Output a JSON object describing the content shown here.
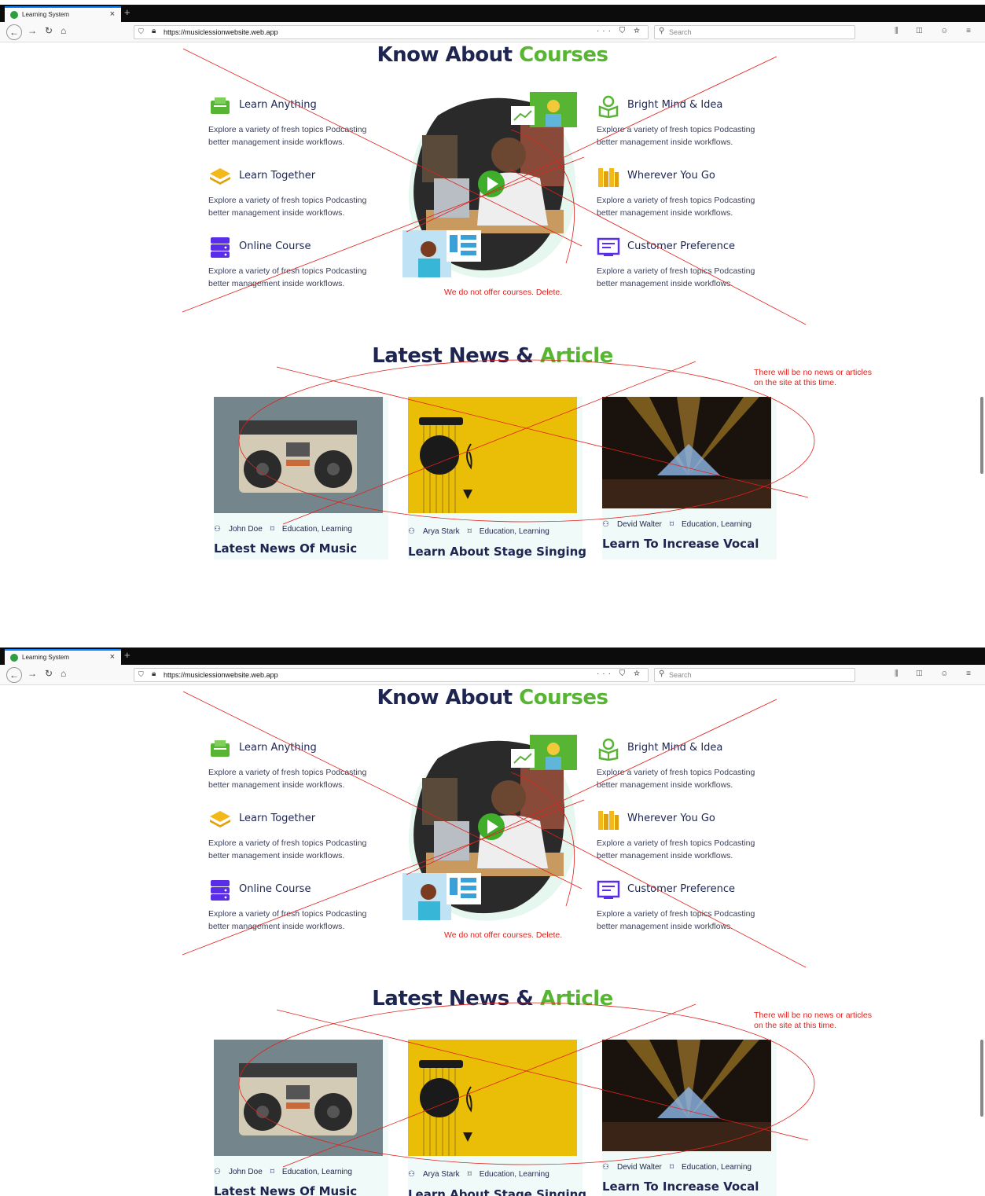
{
  "browser": {
    "tab_title": "Learning System",
    "url": "https://musiclessionwebsite.web.app",
    "search_placeholder": "Search"
  },
  "courses": {
    "heading_part1": "Know About ",
    "heading_accent": "Courses",
    "features_left": [
      {
        "title": "Learn Anything",
        "desc": "Explore a variety of fresh topics Podcasting better management inside workflows.",
        "icon": "book-icon",
        "color": "#58b433"
      },
      {
        "title": "Learn Together",
        "desc": "Explore a variety of fresh topics Podcasting better management inside workflows.",
        "icon": "layers-icon",
        "color": "#f3b81a"
      },
      {
        "title": "Online Course",
        "desc": "Explore a variety of fresh topics Podcasting better management inside workflows.",
        "icon": "server-icon",
        "color": "#5a2ee8"
      }
    ],
    "features_right": [
      {
        "title": "Bright Mind & Idea",
        "desc": "Explore a variety of fresh topics Podcasting better management inside workflows.",
        "icon": "idea-icon",
        "color": "#58b433"
      },
      {
        "title": "Wherever You Go",
        "desc": "Explore a variety of fresh topics Podcasting better management inside workflows.",
        "icon": "library-icon",
        "color": "#f3b81a"
      },
      {
        "title": "Customer Preference",
        "desc": "Explore a variety of fresh topics Podcasting better management inside workflows.",
        "icon": "certificate-icon",
        "color": "#5a2ee8"
      }
    ],
    "annotation": "We do not offer courses. Delete."
  },
  "news": {
    "heading_part1": "Latest News & ",
    "heading_accent": "Article",
    "annotation_line1": "There will be no news or articles",
    "annotation_line2": "on the site at this time.",
    "cards": [
      {
        "author": "John Doe",
        "category": "Education, Learning",
        "title": "Latest News Of Music",
        "image": "boombox"
      },
      {
        "author": "Arya Stark",
        "category": "Education, Learning",
        "title": "Learn About Stage Singing",
        "image": "guitar"
      },
      {
        "author": "Devid Walter",
        "category": "Education, Learning",
        "title": "Learn To Increase Vocal",
        "image": "concert"
      }
    ]
  },
  "colors": {
    "accent": "#58b433",
    "annotation": "#e0201a",
    "heading": "#1d2550"
  }
}
